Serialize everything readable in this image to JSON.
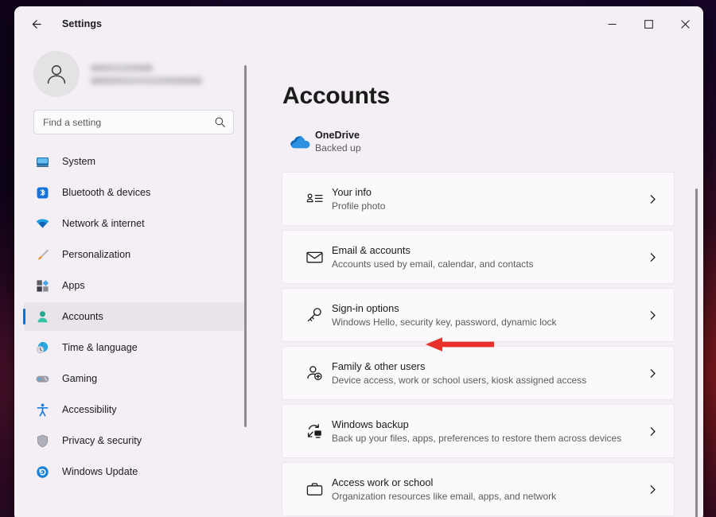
{
  "window": {
    "app_title": "Settings",
    "back_icon": "back-arrow-icon",
    "minimize_label": "—",
    "maximize_label": "□",
    "close_label": "✕",
    "accent_color": "#0c72d0",
    "window_bg": "#f3eff5",
    "card_bg": "#fbf9fb"
  },
  "sidebar": {
    "account": {
      "name": "",
      "email": "",
      "avatar_icon": "person-avatar-icon"
    },
    "search": {
      "placeholder": "Find a setting",
      "value": "",
      "icon": "search-icon"
    },
    "items": [
      {
        "label": "System",
        "icon": "monitor-icon",
        "active": false
      },
      {
        "label": "Bluetooth & devices",
        "icon": "bluetooth-icon",
        "active": false
      },
      {
        "label": "Network & internet",
        "icon": "wifi-icon",
        "active": false
      },
      {
        "label": "Personalization",
        "icon": "paintbrush-icon",
        "active": false
      },
      {
        "label": "Apps",
        "icon": "apps-grid-icon",
        "active": false
      },
      {
        "label": "Accounts",
        "icon": "person-icon",
        "active": true
      },
      {
        "label": "Time & language",
        "icon": "clock-globe-icon",
        "active": false
      },
      {
        "label": "Gaming",
        "icon": "gamepad-icon",
        "active": false
      },
      {
        "label": "Accessibility",
        "icon": "accessibility-icon",
        "active": false
      },
      {
        "label": "Privacy & security",
        "icon": "shield-icon",
        "active": false
      },
      {
        "label": "Windows Update",
        "icon": "update-refresh-icon",
        "active": false
      }
    ]
  },
  "main": {
    "page_title": "Accounts",
    "onedrive": {
      "icon": "onedrive-cloud-icon",
      "title": "OneDrive",
      "status": "Backed up"
    },
    "cards": [
      {
        "title": "Your info",
        "subtitle": "Profile photo",
        "icon": "contact-card-icon",
        "chevron": "chevron-right-icon"
      },
      {
        "title": "Email & accounts",
        "subtitle": "Accounts used by email, calendar, and contacts",
        "icon": "envelope-icon",
        "chevron": "chevron-right-icon"
      },
      {
        "title": "Sign-in options",
        "subtitle": "Windows Hello, security key, password, dynamic lock",
        "icon": "key-icon",
        "chevron": "chevron-right-icon"
      },
      {
        "title": "Family & other users",
        "subtitle": "Device access, work or school users, kiosk assigned access",
        "icon": "person-add-icon",
        "chevron": "chevron-right-icon"
      },
      {
        "title": "Windows backup",
        "subtitle": "Back up your files, apps, preferences to restore them across devices",
        "icon": "pc-restore-icon",
        "chevron": "chevron-right-icon"
      },
      {
        "title": "Access work or school",
        "subtitle": "Organization resources like email, apps, and network",
        "icon": "briefcase-icon",
        "chevron": "chevron-right-icon"
      }
    ]
  },
  "annotation": {
    "type": "arrow-left",
    "color": "#e8302a",
    "points_to": "Family & other users"
  }
}
